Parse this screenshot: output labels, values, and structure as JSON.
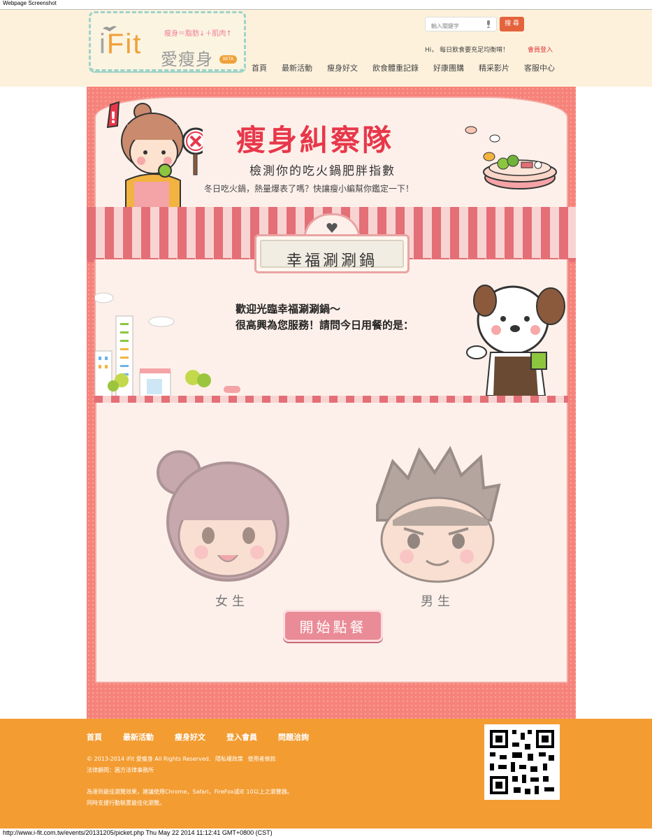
{
  "screenshot_title": "Webpage Screenshot",
  "header": {
    "logo": {
      "mark_prefix": "i",
      "mark_suffix": "Fit",
      "tagline": "瘦身＝脂肪↓＋肌肉↑",
      "name_cn": "愛瘦身",
      "badge": "BETA"
    },
    "search": {
      "placeholder": "輸入關鍵字",
      "button": "搜 尋"
    },
    "greeting": "Hi， 每日飲食要充足均衡唷！",
    "login": "會員登入",
    "nav": [
      "首頁",
      "最新活動",
      "瘦身好文",
      "飲食體重記錄",
      "好康團購",
      "精采影片",
      "客服中心"
    ]
  },
  "banner": {
    "title": "瘦身糾察隊",
    "subtitle": "檢測你的吃火鍋肥胖指數",
    "intro": "冬日吃火鍋，熱量爆表了嗎？快讓瘦小編幫你鑑定一下！"
  },
  "shop": {
    "sign": "幸福涮涮鍋",
    "welcome_line1": "歡迎光臨幸福涮涮鍋～",
    "welcome_line2": "很高興為您服務！請問今日用餐的是："
  },
  "choice": {
    "female": "女生",
    "male": "男生",
    "start_button": "開始點餐"
  },
  "footer": {
    "nav": [
      "首頁",
      "最新活動",
      "瘦身好文",
      "登入會員",
      "問題洽詢"
    ],
    "copyright": "© 2013-2014 iFit 愛瘦身 All Rights Reserved.",
    "privacy": "隱私權政策",
    "terms": "使用者條款",
    "legal": "法律顧問：圓方法律事務所",
    "browser_note": "為達到最佳瀏覽效果，建議使用Chrome，Safari，FireFox或IE 10以上之瀏覽器。",
    "mobile_note": "同時支援行動裝置最佳化瀏覽。"
  },
  "status_bar": "http://www.i-fit.com.tw/events/20131205/picket.php Thu May 22 2014 11:12:41 GMT+0800 (CST)",
  "colors": {
    "header_bg": "#fdf1dc",
    "accent_red": "#e8374a",
    "panel_pink": "#f6837b",
    "footer_orange": "#f39c32",
    "search_button": "#e4633c"
  }
}
